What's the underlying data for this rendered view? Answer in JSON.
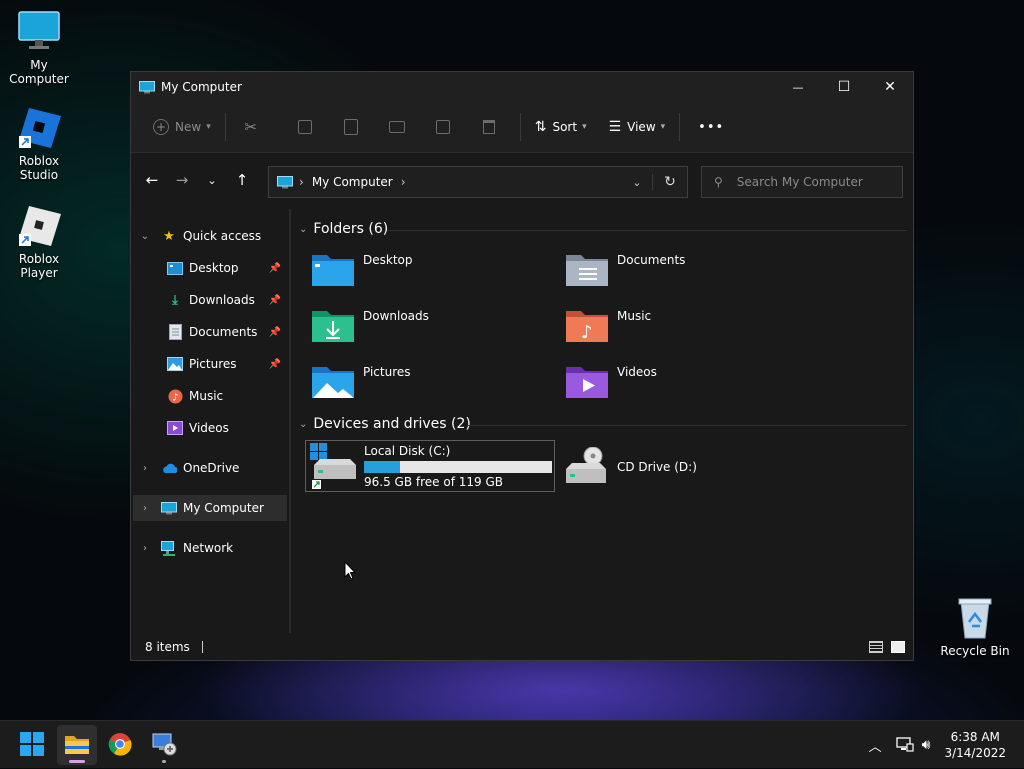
{
  "desktop": {
    "icons": [
      {
        "label": "My Computer",
        "icon": "monitor-icon"
      },
      {
        "label": "Roblox Studio",
        "icon": "roblox-studio-icon"
      },
      {
        "label": "Roblox Player",
        "icon": "roblox-player-icon"
      },
      {
        "label": "Recycle Bin",
        "icon": "recycle-bin-icon"
      }
    ]
  },
  "window": {
    "title": "My Computer",
    "controls": {
      "minimize": "—",
      "maximize": "☐",
      "close": "✕"
    }
  },
  "toolbar": {
    "new_label": "New",
    "sort_label": "Sort",
    "view_label": "View",
    "more_label": "•••"
  },
  "address": {
    "path": "My Computer",
    "separator": "›"
  },
  "search": {
    "placeholder": "Search My Computer"
  },
  "sidebar": {
    "quick_access": "Quick access",
    "quick_items": [
      {
        "label": "Desktop",
        "pinned": true
      },
      {
        "label": "Downloads",
        "pinned": true
      },
      {
        "label": "Documents",
        "pinned": true
      },
      {
        "label": "Pictures",
        "pinned": true
      },
      {
        "label": "Music",
        "pinned": false
      },
      {
        "label": "Videos",
        "pinned": false
      }
    ],
    "onedrive": "OneDrive",
    "my_computer": "My Computer",
    "network": "Network"
  },
  "content": {
    "folders_header": "Folders (6)",
    "folders": [
      "Desktop",
      "Documents",
      "Downloads",
      "Music",
      "Pictures",
      "Videos"
    ],
    "drives_header": "Devices and drives (2)",
    "drives": [
      {
        "name": "Local Disk (C:)",
        "free_text": "96.5 GB free of 119 GB",
        "used_fraction": 0.19
      },
      {
        "name": "CD Drive (D:)"
      }
    ]
  },
  "status": {
    "items": "8 items"
  },
  "clock": {
    "time": "6:38 AM",
    "date": "3/14/2022"
  },
  "colors": {
    "accent": "#26a0da",
    "window_bg": "#191919",
    "taskbar_bg": "#1c1c1c"
  }
}
